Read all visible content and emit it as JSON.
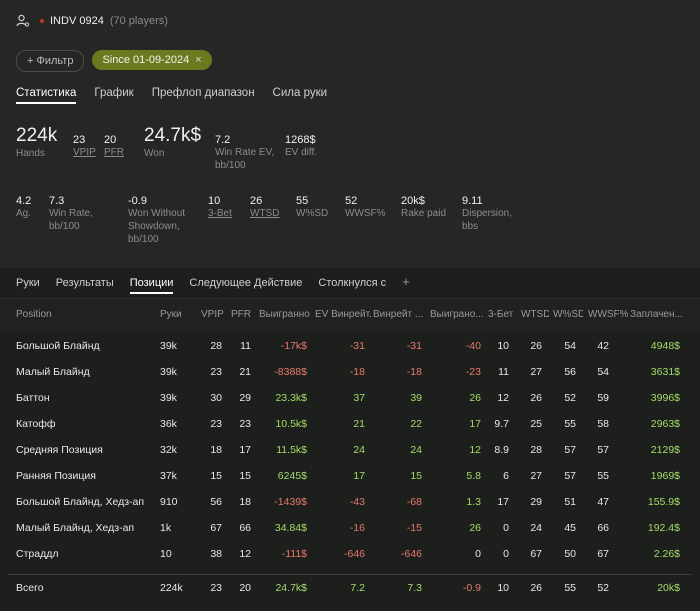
{
  "header": {
    "title": "INDV 0924",
    "players": "(70 players)"
  },
  "chips": {
    "filter_label": "+ Фильтр",
    "date_label": "Since 01-09-2024",
    "close": "×"
  },
  "tabs_top": [
    "Статистика",
    "График",
    "Префлоп диапазон",
    "Сила руки"
  ],
  "stats1": [
    {
      "value": "224k",
      "label": "Hands"
    },
    {
      "value": "23",
      "label": "VPIP"
    },
    {
      "value": "20",
      "label": "PFR"
    },
    {
      "value": "24.7k$",
      "label": "Won"
    },
    {
      "value": "7.2",
      "label": "Win Rate EV,",
      "label2": "bb/100"
    },
    {
      "value": "1268$",
      "label": "EV diff."
    }
  ],
  "stats2": [
    {
      "value": "4.2",
      "label": "Ag."
    },
    {
      "value": "7.3",
      "label": "Win Rate,",
      "label2": "bb/100"
    },
    {
      "value": "-0.9",
      "label": "Won Without",
      "label2": "Showdown,",
      "label3": "bb/100"
    },
    {
      "value": "10",
      "label": "3-Bet"
    },
    {
      "value": "26",
      "label": "WTSD"
    },
    {
      "value": "55",
      "label": "W%SD"
    },
    {
      "value": "52",
      "label": "WWSF%"
    },
    {
      "value": "20k$",
      "label": "Rake paid"
    },
    {
      "value": "9.11",
      "label": "Dispersion,",
      "label2": "bbs"
    }
  ],
  "tabs_bottom": [
    "Руки",
    "Результаты",
    "Позиции",
    "Следующее Действие",
    "Столкнулся с",
    "+"
  ],
  "columns": [
    "Position",
    "Руки",
    "VPIP",
    "PFR",
    "Выигранно",
    "EV Винрейт...",
    "Винрейт ...",
    "Выиграно...",
    "3-Бет",
    "WTSD",
    "W%SD",
    "WWSF%",
    "Заплачен..."
  ],
  "rows": [
    [
      "Большой Блайнд",
      "39k",
      "28",
      "11",
      "-17k$",
      "-31",
      "-31",
      "-40",
      "10",
      "26",
      "54",
      "42",
      "4948$"
    ],
    [
      "Малый Блайнд",
      "39k",
      "23",
      "21",
      "-8388$",
      "-18",
      "-18",
      "-23",
      "11",
      "27",
      "56",
      "54",
      "3631$"
    ],
    [
      "Баттон",
      "39k",
      "30",
      "29",
      "23.3k$",
      "37",
      "39",
      "26",
      "12",
      "26",
      "52",
      "59",
      "3996$"
    ],
    [
      "Катофф",
      "36k",
      "23",
      "23",
      "10.5k$",
      "21",
      "22",
      "17",
      "9.7",
      "25",
      "55",
      "58",
      "2963$"
    ],
    [
      "Средняя Позиция",
      "32k",
      "18",
      "17",
      "11.5k$",
      "24",
      "24",
      "12",
      "8.9",
      "28",
      "57",
      "57",
      "2129$"
    ],
    [
      "Ранняя Позиция",
      "37k",
      "15",
      "15",
      "6245$",
      "17",
      "15",
      "5.8",
      "6",
      "27",
      "57",
      "55",
      "1969$"
    ],
    [
      "Большой Блайнд, Хедз-ап",
      "910",
      "56",
      "18",
      "-1439$",
      "-43",
      "-68",
      "1.3",
      "17",
      "29",
      "51",
      "47",
      "155.9$"
    ],
    [
      "Малый Блайнд, Хедз-ап",
      "1k",
      "67",
      "66",
      "34.84$",
      "-16",
      "-15",
      "26",
      "0",
      "24",
      "45",
      "66",
      "192.4$"
    ],
    [
      "Страддл",
      "10",
      "38",
      "12",
      "-111$",
      "-646",
      "-646",
      "0",
      "0",
      "67",
      "50",
      "67",
      "2.26$"
    ]
  ],
  "total": [
    "Всего",
    "224k",
    "23",
    "20",
    "24.7k$",
    "7.2",
    "7.3",
    "-0.9",
    "10",
    "26",
    "55",
    "52",
    "20k$"
  ],
  "colors": {
    "positive": "#a6dc6a",
    "negative": "#e8796b",
    "chip_active": "#6b7a1f"
  }
}
